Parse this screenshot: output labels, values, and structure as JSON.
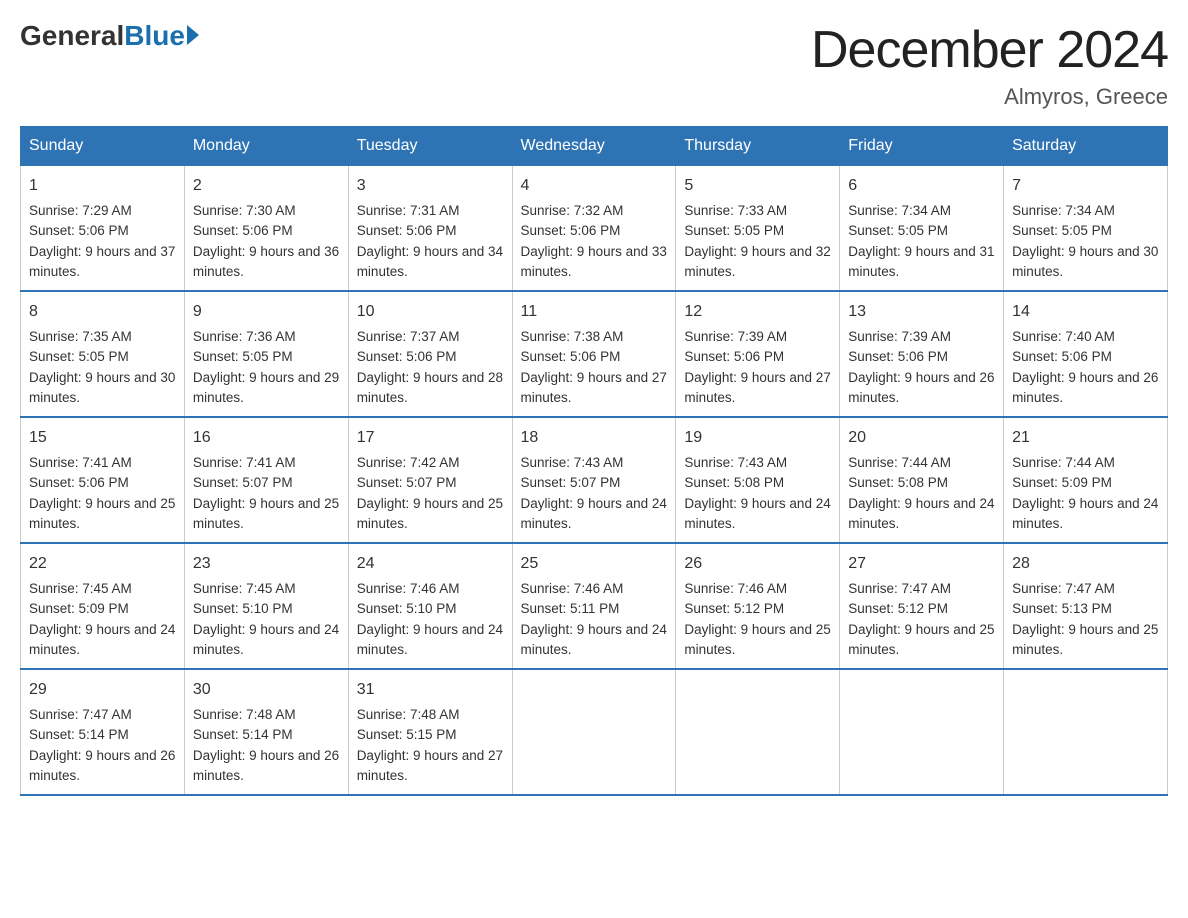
{
  "logo": {
    "general": "General",
    "blue": "Blue"
  },
  "title": "December 2024",
  "location": "Almyros, Greece",
  "days_of_week": [
    "Sunday",
    "Monday",
    "Tuesday",
    "Wednesday",
    "Thursday",
    "Friday",
    "Saturday"
  ],
  "weeks": [
    [
      {
        "day": "1",
        "sunrise": "7:29 AM",
        "sunset": "5:06 PM",
        "daylight": "9 hours and 37 minutes."
      },
      {
        "day": "2",
        "sunrise": "7:30 AM",
        "sunset": "5:06 PM",
        "daylight": "9 hours and 36 minutes."
      },
      {
        "day": "3",
        "sunrise": "7:31 AM",
        "sunset": "5:06 PM",
        "daylight": "9 hours and 34 minutes."
      },
      {
        "day": "4",
        "sunrise": "7:32 AM",
        "sunset": "5:06 PM",
        "daylight": "9 hours and 33 minutes."
      },
      {
        "day": "5",
        "sunrise": "7:33 AM",
        "sunset": "5:05 PM",
        "daylight": "9 hours and 32 minutes."
      },
      {
        "day": "6",
        "sunrise": "7:34 AM",
        "sunset": "5:05 PM",
        "daylight": "9 hours and 31 minutes."
      },
      {
        "day": "7",
        "sunrise": "7:34 AM",
        "sunset": "5:05 PM",
        "daylight": "9 hours and 30 minutes."
      }
    ],
    [
      {
        "day": "8",
        "sunrise": "7:35 AM",
        "sunset": "5:05 PM",
        "daylight": "9 hours and 30 minutes."
      },
      {
        "day": "9",
        "sunrise": "7:36 AM",
        "sunset": "5:05 PM",
        "daylight": "9 hours and 29 minutes."
      },
      {
        "day": "10",
        "sunrise": "7:37 AM",
        "sunset": "5:06 PM",
        "daylight": "9 hours and 28 minutes."
      },
      {
        "day": "11",
        "sunrise": "7:38 AM",
        "sunset": "5:06 PM",
        "daylight": "9 hours and 27 minutes."
      },
      {
        "day": "12",
        "sunrise": "7:39 AM",
        "sunset": "5:06 PM",
        "daylight": "9 hours and 27 minutes."
      },
      {
        "day": "13",
        "sunrise": "7:39 AM",
        "sunset": "5:06 PM",
        "daylight": "9 hours and 26 minutes."
      },
      {
        "day": "14",
        "sunrise": "7:40 AM",
        "sunset": "5:06 PM",
        "daylight": "9 hours and 26 minutes."
      }
    ],
    [
      {
        "day": "15",
        "sunrise": "7:41 AM",
        "sunset": "5:06 PM",
        "daylight": "9 hours and 25 minutes."
      },
      {
        "day": "16",
        "sunrise": "7:41 AM",
        "sunset": "5:07 PM",
        "daylight": "9 hours and 25 minutes."
      },
      {
        "day": "17",
        "sunrise": "7:42 AM",
        "sunset": "5:07 PM",
        "daylight": "9 hours and 25 minutes."
      },
      {
        "day": "18",
        "sunrise": "7:43 AM",
        "sunset": "5:07 PM",
        "daylight": "9 hours and 24 minutes."
      },
      {
        "day": "19",
        "sunrise": "7:43 AM",
        "sunset": "5:08 PM",
        "daylight": "9 hours and 24 minutes."
      },
      {
        "day": "20",
        "sunrise": "7:44 AM",
        "sunset": "5:08 PM",
        "daylight": "9 hours and 24 minutes."
      },
      {
        "day": "21",
        "sunrise": "7:44 AM",
        "sunset": "5:09 PM",
        "daylight": "9 hours and 24 minutes."
      }
    ],
    [
      {
        "day": "22",
        "sunrise": "7:45 AM",
        "sunset": "5:09 PM",
        "daylight": "9 hours and 24 minutes."
      },
      {
        "day": "23",
        "sunrise": "7:45 AM",
        "sunset": "5:10 PM",
        "daylight": "9 hours and 24 minutes."
      },
      {
        "day": "24",
        "sunrise": "7:46 AM",
        "sunset": "5:10 PM",
        "daylight": "9 hours and 24 minutes."
      },
      {
        "day": "25",
        "sunrise": "7:46 AM",
        "sunset": "5:11 PM",
        "daylight": "9 hours and 24 minutes."
      },
      {
        "day": "26",
        "sunrise": "7:46 AM",
        "sunset": "5:12 PM",
        "daylight": "9 hours and 25 minutes."
      },
      {
        "day": "27",
        "sunrise": "7:47 AM",
        "sunset": "5:12 PM",
        "daylight": "9 hours and 25 minutes."
      },
      {
        "day": "28",
        "sunrise": "7:47 AM",
        "sunset": "5:13 PM",
        "daylight": "9 hours and 25 minutes."
      }
    ],
    [
      {
        "day": "29",
        "sunrise": "7:47 AM",
        "sunset": "5:14 PM",
        "daylight": "9 hours and 26 minutes."
      },
      {
        "day": "30",
        "sunrise": "7:48 AM",
        "sunset": "5:14 PM",
        "daylight": "9 hours and 26 minutes."
      },
      {
        "day": "31",
        "sunrise": "7:48 AM",
        "sunset": "5:15 PM",
        "daylight": "9 hours and 27 minutes."
      },
      null,
      null,
      null,
      null
    ]
  ]
}
